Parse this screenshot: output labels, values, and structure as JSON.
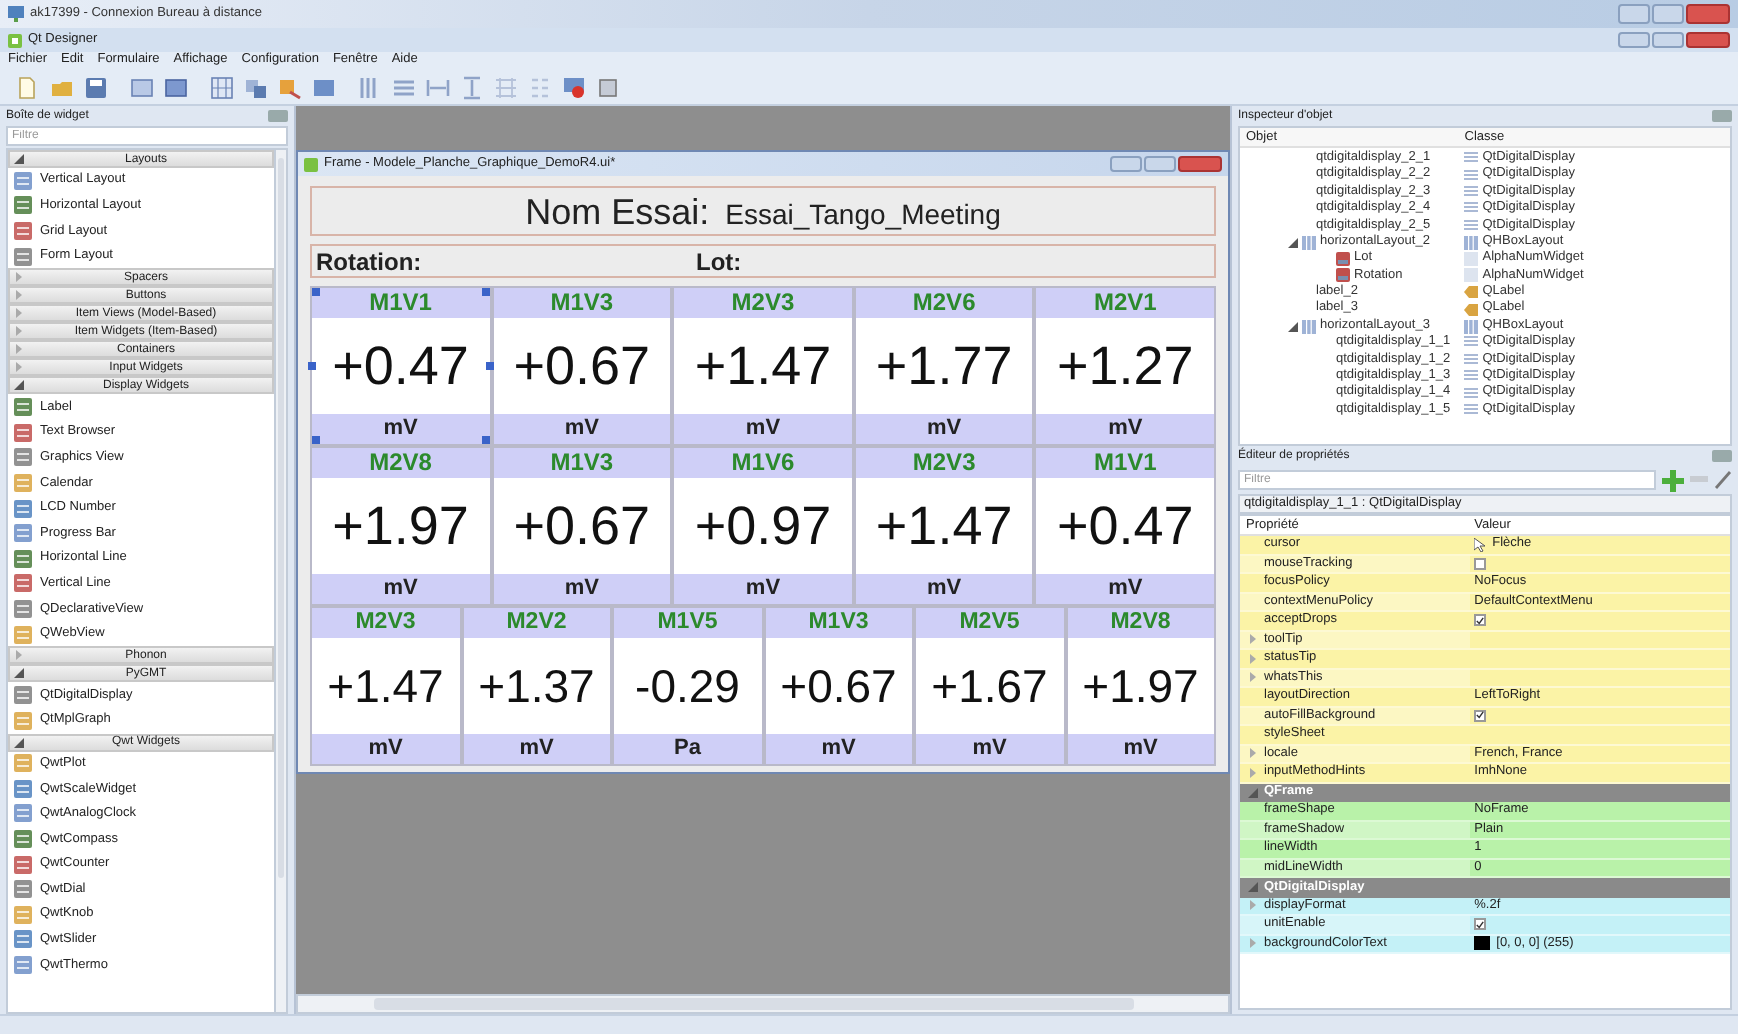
{
  "remote_window": {
    "title": "ak17399 - Connexion Bureau à distance"
  },
  "app": {
    "title": "Qt Designer"
  },
  "menu": [
    "Fichier",
    "Edit",
    "Formulaire",
    "Affichage",
    "Configuration",
    "Fenêtre",
    "Aide"
  ],
  "widget_box": {
    "title": "Boîte de widget",
    "filter_placeholder": "Filtre",
    "categories": [
      {
        "label": "Layouts",
        "expanded": true,
        "items": [
          "Vertical Layout",
          "Horizontal Layout",
          "Grid Layout",
          "Form Layout"
        ]
      },
      {
        "label": "Spacers",
        "expanded": false
      },
      {
        "label": "Buttons",
        "expanded": false
      },
      {
        "label": "Item Views (Model-Based)",
        "expanded": false
      },
      {
        "label": "Item Widgets (Item-Based)",
        "expanded": false
      },
      {
        "label": "Containers",
        "expanded": false
      },
      {
        "label": "Input Widgets",
        "expanded": false
      },
      {
        "label": "Display Widgets",
        "expanded": true,
        "items": [
          "Label",
          "Text Browser",
          "Graphics View",
          "Calendar",
          "LCD Number",
          "Progress Bar",
          "Horizontal Line",
          "Vertical Line",
          "QDeclarativeView",
          "QWebView"
        ]
      },
      {
        "label": "Phonon",
        "expanded": false
      },
      {
        "label": "PyGMT",
        "expanded": true,
        "items": [
          "QtDigitalDisplay",
          "QtMplGraph"
        ]
      },
      {
        "label": "Qwt Widgets",
        "expanded": true,
        "items": [
          "QwtPlot",
          "QwtScaleWidget",
          "QwtAnalogClock",
          "QwtCompass",
          "QwtCounter",
          "QwtDial",
          "QwtKnob",
          "QwtSlider",
          "QwtThermo"
        ]
      }
    ]
  },
  "form_window": {
    "title": "Frame - Modele_Planche_Graphique_DemoR4.ui*",
    "name_label": "Nom Essai:",
    "name_value": "Essai_Tango_Meeting",
    "rotation_label": "Rotation:",
    "lot_label": "Lot:",
    "display_rows": [
      {
        "displays": [
          {
            "name": "M1V1",
            "value": "+0.47",
            "unit": "mV",
            "selected": true
          },
          {
            "name": "M1V3",
            "value": "+0.67",
            "unit": "mV",
            "selected": false
          },
          {
            "name": "M2V3",
            "value": "+1.47",
            "unit": "mV",
            "selected": false
          },
          {
            "name": "M2V6",
            "value": "+1.77",
            "unit": "mV",
            "selected": false
          },
          {
            "name": "M2V1",
            "value": "+1.27",
            "unit": "mV",
            "selected": false
          }
        ]
      },
      {
        "displays": [
          {
            "name": "M2V8",
            "value": "+1.97",
            "unit": "mV",
            "selected": false
          },
          {
            "name": "M1V3",
            "value": "+0.67",
            "unit": "mV",
            "selected": false
          },
          {
            "name": "M1V6",
            "value": "+0.97",
            "unit": "mV",
            "selected": false
          },
          {
            "name": "M2V3",
            "value": "+1.47",
            "unit": "mV",
            "selected": false
          },
          {
            "name": "M1V1",
            "value": "+0.47",
            "unit": "mV",
            "selected": false
          }
        ]
      },
      {
        "displays": [
          {
            "name": "M2V3",
            "value": "+1.47",
            "unit": "mV",
            "selected": false
          },
          {
            "name": "M2V2",
            "value": "+1.37",
            "unit": "mV",
            "selected": false
          },
          {
            "name": "M1V5",
            "value": "-0.29",
            "unit": "Pa",
            "selected": false
          },
          {
            "name": "M1V3",
            "value": "+0.67",
            "unit": "mV",
            "selected": false
          },
          {
            "name": "M2V5",
            "value": "+1.67",
            "unit": "mV",
            "selected": false
          },
          {
            "name": "M2V8",
            "value": "+1.97",
            "unit": "mV",
            "selected": false
          }
        ]
      }
    ]
  },
  "object_inspector": {
    "title": "Inspecteur d'objet",
    "columns": [
      "Objet",
      "Classe"
    ],
    "tree": [
      {
        "name": "qtdigitaldisplay_2_1",
        "class": "QtDigitalDisplay",
        "kind": "display"
      },
      {
        "name": "qtdigitaldisplay_2_2",
        "class": "QtDigitalDisplay",
        "kind": "display"
      },
      {
        "name": "qtdigitaldisplay_2_3",
        "class": "QtDigitalDisplay",
        "kind": "display"
      },
      {
        "name": "qtdigitaldisplay_2_4",
        "class": "QtDigitalDisplay",
        "kind": "display"
      },
      {
        "name": "qtdigitaldisplay_2_5",
        "class": "QtDigitalDisplay",
        "kind": "display"
      },
      {
        "name": "horizontalLayout_2",
        "class": "QHBoxLayout",
        "kind": "layout",
        "expanded": true,
        "children": [
          {
            "name": "Lot",
            "class": "AlphaNumWidget",
            "kind": "alpha"
          },
          {
            "name": "Rotation",
            "class": "AlphaNumWidget",
            "kind": "alpha"
          }
        ]
      },
      {
        "name": "label_2",
        "class": "QLabel",
        "kind": "label"
      },
      {
        "name": "label_3",
        "class": "QLabel",
        "kind": "label"
      },
      {
        "name": "horizontalLayout_3",
        "class": "QHBoxLayout",
        "kind": "layout",
        "expanded": true,
        "children": [
          {
            "name": "qtdigitaldisplay_1_1",
            "class": "QtDigitalDisplay",
            "kind": "display"
          },
          {
            "name": "qtdigitaldisplay_1_2",
            "class": "QtDigitalDisplay",
            "kind": "display"
          },
          {
            "name": "qtdigitaldisplay_1_3",
            "class": "QtDigitalDisplay",
            "kind": "display"
          },
          {
            "name": "qtdigitaldisplay_1_4",
            "class": "QtDigitalDisplay",
            "kind": "display"
          },
          {
            "name": "qtdigitaldisplay_1_5",
            "class": "QtDigitalDisplay",
            "kind": "display"
          }
        ]
      }
    ]
  },
  "property_editor": {
    "title": "Éditeur de propriétés",
    "filter_placeholder": "Filtre",
    "object": "qtdigitaldisplay_1_1 : QtDigitalDisplay",
    "columns": [
      "Propriété",
      "Valeur"
    ],
    "groups": [
      {
        "color": "#fbf3a6",
        "properties": [
          {
            "name": "cursor",
            "kind": "cursor",
            "value": "Flèche",
            "expandable": false
          },
          {
            "name": "mouseTracking",
            "kind": "check",
            "checked": false,
            "expandable": false
          },
          {
            "name": "focusPolicy",
            "kind": "text",
            "value": "NoFocus",
            "expandable": false
          },
          {
            "name": "contextMenuPolicy",
            "kind": "text",
            "value": "DefaultContextMenu",
            "expandable": false
          },
          {
            "name": "acceptDrops",
            "kind": "check",
            "checked": true,
            "expandable": false
          },
          {
            "name": "toolTip",
            "kind": "text",
            "expandable": true
          },
          {
            "name": "statusTip",
            "kind": "text",
            "expandable": true
          },
          {
            "name": "whatsThis",
            "kind": "text",
            "expandable": true
          },
          {
            "name": "layoutDirection",
            "kind": "text",
            "value": "LeftToRight",
            "expandable": false
          },
          {
            "name": "autoFillBackground",
            "kind": "check",
            "checked": true,
            "expandable": false
          },
          {
            "name": "styleSheet",
            "kind": "text",
            "expandable": false
          },
          {
            "name": "locale",
            "kind": "text",
            "value": "French, France",
            "expandable": true
          },
          {
            "name": "inputMethodHints",
            "kind": "text",
            "value": "ImhNone",
            "expandable": true
          }
        ]
      },
      {
        "label": "QFrame",
        "expanded": true,
        "color": "#b9f2a9",
        "properties": [
          {
            "name": "frameShape",
            "kind": "text",
            "value": "NoFrame",
            "expandable": false
          },
          {
            "name": "frameShadow",
            "kind": "text",
            "value": "Plain",
            "expandable": false
          },
          {
            "name": "lineWidth",
            "kind": "text",
            "value": "1",
            "expandable": false
          },
          {
            "name": "midLineWidth",
            "kind": "text",
            "value": "0",
            "expandable": false
          }
        ]
      },
      {
        "label": "QtDigitalDisplay",
        "expanded": true,
        "color": "#c4f1f7",
        "properties": [
          {
            "name": "displayFormat",
            "kind": "text",
            "value": "%.2f",
            "expandable": true
          },
          {
            "name": "unitEnable",
            "kind": "check",
            "checked": true,
            "expandable": false
          },
          {
            "name": "backgroundColorText",
            "kind": "color",
            "color": "#000000",
            "value": "[0, 0, 0] (255)",
            "expandable": true
          }
        ]
      }
    ]
  }
}
